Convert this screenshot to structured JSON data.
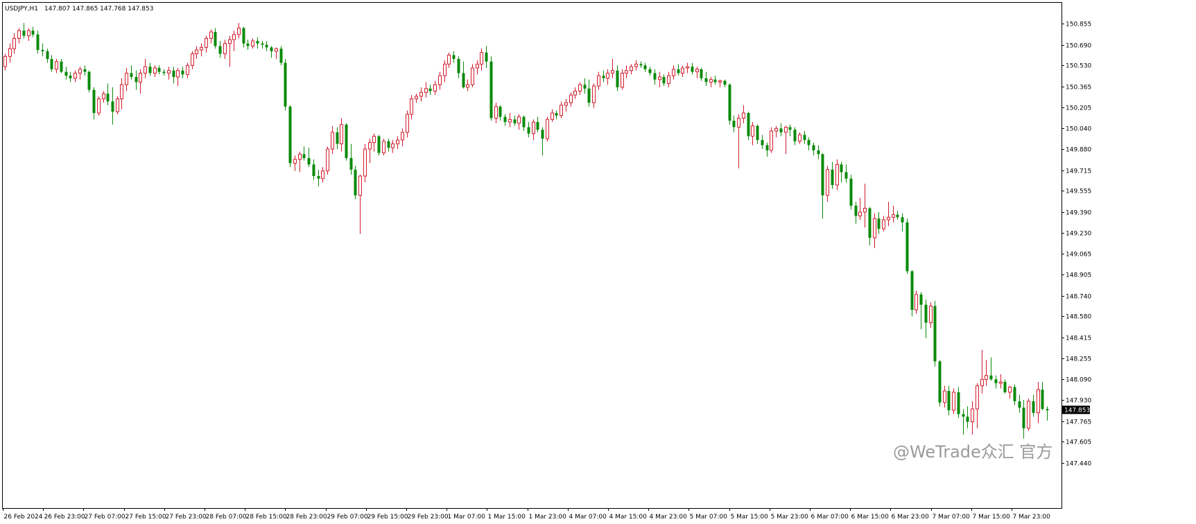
{
  "header": {
    "symbol": "USDJPY,H1",
    "ohlc_text": "147.807 147.865 147.768 147.853"
  },
  "current_price_label": "147.853",
  "watermark": "@WeTrade众汇 官方",
  "colors": {
    "bull": "#d11a2a",
    "bear": "#0a8a0a",
    "background": "#ffffff",
    "axis": "#000000"
  },
  "chart_data": {
    "type": "candlestick",
    "symbol": "USDJPY",
    "timeframe": "H1",
    "ylim": [
      147.44,
      150.92
    ],
    "y_ticks": [
      "150.855",
      "150.690",
      "150.530",
      "150.365",
      "150.205",
      "150.040",
      "149.880",
      "149.715",
      "149.555",
      "149.390",
      "149.230",
      "149.065",
      "148.905",
      "148.740",
      "148.580",
      "148.415",
      "148.255",
      "148.090",
      "147.930",
      "147.765",
      "147.605",
      "147.440"
    ],
    "x_ticks": [
      "26 Feb 2024",
      "26 Feb 23:00",
      "27 Feb 07:00",
      "27 Feb 15:00",
      "27 Feb 23:00",
      "28 Feb 07:00",
      "28 Feb 15:00",
      "28 Feb 23:00",
      "29 Feb 07:00",
      "29 Feb 15:00",
      "29 Feb 23:00",
      "1 Mar 07:00",
      "1 Mar 15:00",
      "1 Mar 23:00",
      "4 Mar 07:00",
      "4 Mar 15:00",
      "4 Mar 23:00",
      "5 Mar 07:00",
      "5 Mar 15:00",
      "5 Mar 23:00",
      "6 Mar 07:00",
      "6 Mar 15:00",
      "6 Mar 23:00",
      "7 Mar 07:00",
      "7 Mar 15:00",
      "7 Mar 23:00"
    ],
    "last_close": 147.853,
    "candles": [
      [
        150.52,
        150.62,
        150.49,
        150.6
      ],
      [
        150.6,
        150.7,
        150.55,
        150.66
      ],
      [
        150.66,
        150.78,
        150.62,
        150.74
      ],
      [
        150.74,
        150.82,
        150.7,
        150.8
      ],
      [
        150.8,
        150.86,
        150.74,
        150.76
      ],
      [
        150.76,
        150.82,
        150.72,
        150.8
      ],
      [
        150.8,
        150.83,
        150.75,
        150.77
      ],
      [
        150.77,
        150.8,
        150.62,
        150.65
      ],
      [
        150.65,
        150.7,
        150.6,
        150.64
      ],
      [
        150.64,
        150.66,
        150.55,
        150.58
      ],
      [
        150.58,
        150.61,
        150.48,
        150.5
      ],
      [
        150.5,
        150.58,
        150.47,
        150.56
      ],
      [
        150.56,
        150.58,
        150.47,
        150.48
      ],
      [
        150.48,
        150.52,
        150.42,
        150.45
      ],
      [
        150.45,
        150.48,
        150.4,
        150.43
      ],
      [
        150.43,
        150.49,
        150.4,
        150.47
      ],
      [
        150.47,
        150.52,
        150.42,
        150.5
      ],
      [
        150.5,
        150.53,
        150.45,
        150.48
      ],
      [
        150.48,
        150.49,
        150.32,
        150.34
      ],
      [
        150.34,
        150.36,
        150.11,
        150.16
      ],
      [
        150.16,
        150.29,
        150.14,
        150.27
      ],
      [
        150.27,
        150.33,
        150.24,
        150.31
      ],
      [
        150.31,
        150.39,
        150.22,
        150.25
      ],
      [
        150.25,
        150.36,
        150.07,
        150.17
      ],
      [
        150.17,
        150.29,
        150.15,
        150.27
      ],
      [
        150.27,
        150.43,
        150.19,
        150.38
      ],
      [
        150.38,
        150.51,
        150.33,
        150.47
      ],
      [
        150.47,
        150.53,
        150.42,
        150.44
      ],
      [
        150.44,
        150.49,
        150.34,
        150.4
      ],
      [
        150.4,
        150.5,
        150.31,
        150.47
      ],
      [
        150.47,
        150.58,
        150.43,
        150.52
      ],
      [
        150.52,
        150.55,
        150.45,
        150.47
      ],
      [
        150.47,
        150.53,
        150.44,
        150.51
      ],
      [
        150.51,
        150.53,
        150.46,
        150.48
      ],
      [
        150.48,
        150.5,
        150.45,
        150.47
      ],
      [
        150.47,
        150.52,
        150.42,
        150.49
      ],
      [
        150.49,
        150.52,
        150.39,
        150.44
      ],
      [
        150.44,
        150.51,
        150.37,
        150.49
      ],
      [
        150.49,
        150.52,
        150.43,
        150.46
      ],
      [
        150.46,
        150.55,
        150.43,
        150.53
      ],
      [
        150.53,
        150.64,
        150.5,
        150.62
      ],
      [
        150.62,
        150.68,
        150.58,
        150.65
      ],
      [
        150.65,
        150.7,
        150.6,
        150.67
      ],
      [
        150.67,
        150.76,
        150.63,
        150.74
      ],
      [
        150.74,
        150.81,
        150.7,
        150.79
      ],
      [
        150.79,
        150.82,
        150.66,
        150.68
      ],
      [
        150.68,
        150.72,
        150.59,
        150.62
      ],
      [
        150.62,
        150.73,
        150.58,
        150.7
      ],
      [
        150.7,
        150.76,
        150.52,
        150.73
      ],
      [
        150.73,
        150.8,
        150.64,
        150.77
      ],
      [
        150.77,
        150.86,
        150.74,
        150.82
      ],
      [
        150.82,
        150.83,
        150.67,
        150.7
      ],
      [
        150.7,
        150.73,
        150.65,
        150.68
      ],
      [
        150.68,
        150.74,
        150.66,
        150.72
      ],
      [
        150.72,
        150.75,
        150.66,
        150.7
      ],
      [
        150.7,
        150.72,
        150.66,
        150.69
      ],
      [
        150.69,
        150.72,
        150.64,
        150.67
      ],
      [
        150.67,
        150.68,
        150.59,
        150.64
      ],
      [
        150.64,
        150.67,
        150.58,
        150.66
      ],
      [
        150.66,
        150.68,
        150.53,
        150.55
      ],
      [
        150.55,
        150.58,
        150.18,
        150.21
      ],
      [
        150.21,
        150.22,
        149.74,
        149.77
      ],
      [
        149.77,
        149.83,
        149.71,
        149.8
      ],
      [
        149.8,
        149.86,
        149.7,
        149.84
      ],
      [
        149.84,
        149.9,
        149.79,
        149.81
      ],
      [
        149.81,
        149.89,
        149.74,
        149.76
      ],
      [
        149.76,
        149.8,
        149.64,
        149.67
      ],
      [
        149.67,
        149.72,
        149.59,
        149.65
      ],
      [
        149.65,
        149.74,
        149.62,
        149.71
      ],
      [
        149.71,
        149.9,
        149.68,
        149.88
      ],
      [
        149.88,
        150.06,
        149.84,
        150.01
      ],
      [
        150.01,
        150.05,
        149.88,
        149.92
      ],
      [
        149.92,
        150.12,
        149.86,
        150.07
      ],
      [
        150.07,
        150.08,
        149.79,
        149.81
      ],
      [
        149.81,
        149.92,
        149.68,
        149.72
      ],
      [
        149.72,
        149.75,
        149.49,
        149.52
      ],
      [
        149.52,
        149.68,
        149.22,
        149.67
      ],
      [
        149.67,
        149.92,
        149.62,
        149.88
      ],
      [
        149.88,
        149.96,
        149.77,
        149.93
      ],
      [
        149.93,
        150.0,
        149.86,
        149.98
      ],
      [
        149.98,
        149.99,
        149.83,
        149.85
      ],
      [
        149.85,
        149.96,
        149.83,
        149.94
      ],
      [
        149.94,
        149.96,
        149.86,
        149.89
      ],
      [
        149.89,
        149.95,
        149.85,
        149.92
      ],
      [
        149.92,
        149.98,
        149.88,
        149.95
      ],
      [
        149.95,
        150.04,
        149.9,
        150.01
      ],
      [
        150.01,
        150.18,
        149.97,
        150.15
      ],
      [
        150.15,
        150.3,
        150.11,
        150.27
      ],
      [
        150.27,
        150.31,
        150.24,
        150.29
      ],
      [
        150.29,
        150.36,
        150.25,
        150.32
      ],
      [
        150.32,
        150.4,
        150.28,
        150.35
      ],
      [
        150.35,
        150.38,
        150.3,
        150.33
      ],
      [
        150.33,
        150.41,
        150.3,
        150.38
      ],
      [
        150.38,
        150.48,
        150.34,
        150.45
      ],
      [
        150.45,
        150.57,
        150.4,
        150.54
      ],
      [
        150.54,
        150.63,
        150.51,
        150.61
      ],
      [
        150.61,
        150.64,
        150.55,
        150.58
      ],
      [
        150.58,
        150.6,
        150.43,
        150.47
      ],
      [
        150.47,
        150.56,
        150.35,
        150.36
      ],
      [
        150.36,
        150.42,
        150.33,
        150.38
      ],
      [
        150.38,
        150.54,
        150.36,
        150.51
      ],
      [
        150.51,
        150.57,
        150.46,
        150.54
      ],
      [
        150.54,
        150.66,
        150.49,
        150.63
      ],
      [
        150.63,
        150.68,
        150.51,
        150.56
      ],
      [
        150.56,
        150.6,
        150.1,
        150.12
      ],
      [
        150.12,
        150.24,
        150.08,
        150.21
      ],
      [
        150.21,
        150.22,
        150.1,
        150.13
      ],
      [
        150.13,
        150.15,
        150.06,
        150.09
      ],
      [
        150.09,
        150.16,
        150.05,
        150.11
      ],
      [
        150.11,
        150.14,
        150.06,
        150.08
      ],
      [
        150.08,
        150.15,
        150.03,
        150.13
      ],
      [
        150.13,
        150.14,
        150.02,
        150.05
      ],
      [
        150.05,
        150.09,
        149.97,
        150.0
      ],
      [
        150.0,
        150.11,
        149.95,
        150.09
      ],
      [
        150.09,
        150.13,
        150.01,
        150.03
      ],
      [
        150.03,
        150.05,
        149.83,
        149.96
      ],
      [
        149.96,
        150.13,
        149.94,
        150.11
      ],
      [
        150.11,
        150.19,
        150.09,
        150.16
      ],
      [
        150.16,
        150.18,
        150.11,
        150.14
      ],
      [
        150.14,
        150.25,
        150.12,
        150.22
      ],
      [
        150.22,
        150.27,
        150.17,
        150.24
      ],
      [
        150.24,
        150.32,
        150.21,
        150.3
      ],
      [
        150.3,
        150.36,
        150.27,
        150.33
      ],
      [
        150.33,
        150.4,
        150.3,
        150.38
      ],
      [
        150.38,
        150.43,
        150.31,
        150.35
      ],
      [
        150.35,
        150.42,
        150.21,
        150.24
      ],
      [
        150.24,
        150.39,
        150.2,
        150.37
      ],
      [
        150.37,
        150.48,
        150.34,
        150.45
      ],
      [
        150.45,
        150.49,
        150.4,
        150.43
      ],
      [
        150.43,
        150.5,
        150.38,
        150.47
      ],
      [
        150.47,
        150.58,
        150.43,
        150.49
      ],
      [
        150.49,
        150.53,
        150.33,
        150.36
      ],
      [
        150.36,
        150.5,
        150.34,
        150.47
      ],
      [
        150.47,
        150.53,
        150.43,
        150.49
      ],
      [
        150.49,
        150.54,
        150.46,
        150.52
      ],
      [
        150.52,
        150.57,
        150.49,
        150.54
      ],
      [
        150.54,
        150.56,
        150.51,
        150.53
      ],
      [
        150.53,
        150.55,
        150.48,
        150.5
      ],
      [
        150.5,
        150.52,
        150.45,
        150.47
      ],
      [
        150.47,
        150.5,
        150.38,
        150.42
      ],
      [
        150.42,
        150.48,
        150.36,
        150.44
      ],
      [
        150.44,
        150.46,
        150.37,
        150.39
      ],
      [
        150.39,
        150.48,
        150.36,
        150.45
      ],
      [
        150.45,
        150.53,
        150.42,
        150.5
      ],
      [
        150.5,
        150.54,
        150.45,
        150.47
      ],
      [
        150.47,
        150.53,
        150.44,
        150.51
      ],
      [
        150.51,
        150.55,
        150.47,
        150.52
      ],
      [
        150.52,
        150.55,
        150.46,
        150.48
      ],
      [
        150.48,
        150.52,
        150.43,
        150.5
      ],
      [
        150.5,
        150.51,
        150.41,
        150.43
      ],
      [
        150.43,
        150.48,
        150.37,
        150.4
      ],
      [
        150.4,
        150.44,
        150.36,
        150.42
      ],
      [
        150.42,
        150.45,
        150.38,
        150.4
      ],
      [
        150.4,
        150.42,
        150.36,
        150.41
      ],
      [
        150.41,
        150.42,
        150.36,
        150.38
      ],
      [
        150.38,
        150.39,
        150.07,
        150.1
      ],
      [
        150.1,
        150.14,
        150.01,
        150.05
      ],
      [
        150.05,
        150.15,
        149.73,
        150.12
      ],
      [
        150.12,
        150.22,
        150.08,
        150.16
      ],
      [
        150.16,
        150.17,
        149.95,
        149.98
      ],
      [
        149.98,
        150.09,
        149.91,
        150.06
      ],
      [
        150.06,
        150.07,
        149.92,
        149.95
      ],
      [
        149.95,
        149.99,
        149.88,
        149.91
      ],
      [
        149.91,
        149.93,
        149.82,
        149.87
      ],
      [
        149.87,
        150.05,
        149.85,
        150.02
      ],
      [
        150.02,
        150.06,
        149.97,
        150.04
      ],
      [
        150.04,
        150.08,
        149.98,
        150.01
      ],
      [
        150.01,
        150.06,
        149.84,
        150.05
      ],
      [
        150.05,
        150.07,
        149.98,
        150.03
      ],
      [
        150.03,
        150.05,
        149.91,
        149.94
      ],
      [
        149.94,
        150.01,
        149.92,
        149.99
      ],
      [
        149.99,
        150.02,
        149.92,
        149.95
      ],
      [
        149.95,
        149.97,
        149.87,
        149.91
      ],
      [
        149.91,
        149.93,
        149.83,
        149.87
      ],
      [
        149.87,
        149.91,
        149.8,
        149.84
      ],
      [
        149.84,
        149.85,
        149.34,
        149.52
      ],
      [
        149.52,
        149.75,
        149.47,
        149.72
      ],
      [
        149.72,
        149.78,
        149.57,
        149.6
      ],
      [
        149.6,
        149.8,
        149.56,
        149.76
      ],
      [
        149.76,
        149.78,
        149.62,
        149.7
      ],
      [
        149.7,
        149.76,
        149.62,
        149.65
      ],
      [
        149.65,
        149.68,
        149.41,
        149.44
      ],
      [
        149.44,
        149.47,
        149.3,
        149.36
      ],
      [
        149.36,
        149.5,
        149.33,
        149.39
      ],
      [
        149.39,
        149.61,
        149.27,
        149.42
      ],
      [
        149.42,
        149.43,
        149.13,
        149.19
      ],
      [
        149.19,
        149.38,
        149.11,
        149.34
      ],
      [
        149.34,
        149.39,
        149.22,
        149.26
      ],
      [
        149.26,
        149.36,
        149.24,
        149.33
      ],
      [
        149.33,
        149.47,
        149.28,
        149.35
      ],
      [
        149.35,
        149.44,
        149.31,
        149.37
      ],
      [
        149.37,
        149.4,
        149.33,
        149.35
      ],
      [
        149.35,
        149.38,
        149.24,
        149.31
      ],
      [
        149.31,
        149.34,
        148.91,
        148.93
      ],
      [
        148.93,
        148.94,
        148.58,
        148.63
      ],
      [
        148.63,
        148.78,
        148.6,
        148.75
      ],
      [
        148.75,
        148.77,
        148.48,
        148.67
      ],
      [
        148.67,
        148.71,
        148.41,
        148.53
      ],
      [
        148.53,
        148.69,
        148.49,
        148.66
      ],
      [
        148.66,
        148.7,
        148.19,
        148.23
      ],
      [
        148.23,
        148.24,
        147.88,
        147.91
      ],
      [
        147.91,
        148.04,
        147.87,
        148.0
      ],
      [
        148.0,
        148.04,
        147.81,
        147.85
      ],
      [
        147.85,
        148.02,
        147.82,
        147.99
      ],
      [
        147.99,
        148.03,
        147.79,
        147.82
      ],
      [
        147.82,
        147.86,
        147.66,
        147.8
      ],
      [
        147.8,
        147.88,
        147.71,
        147.76
      ],
      [
        147.76,
        147.92,
        147.66,
        147.86
      ],
      [
        147.86,
        148.06,
        147.71,
        148.04
      ],
      [
        148.04,
        148.32,
        147.98,
        148.09
      ],
      [
        148.09,
        148.24,
        148.04,
        148.12
      ],
      [
        148.12,
        148.26,
        148.08,
        148.09
      ],
      [
        148.09,
        148.12,
        148.02,
        148.06
      ],
      [
        148.06,
        148.13,
        148.02,
        148.07
      ],
      [
        148.07,
        148.09,
        147.98,
        147.99
      ],
      [
        147.99,
        148.04,
        147.94,
        148.03
      ],
      [
        148.03,
        148.05,
        147.89,
        147.92
      ],
      [
        147.92,
        147.97,
        147.83,
        147.87
      ],
      [
        147.87,
        147.93,
        147.63,
        147.71
      ],
      [
        147.71,
        147.94,
        147.69,
        147.92
      ],
      [
        147.92,
        147.97,
        147.8,
        147.83
      ],
      [
        147.83,
        148.07,
        147.75,
        148.01
      ],
      [
        148.01,
        148.07,
        147.85,
        147.86
      ],
      [
        147.86,
        147.88,
        147.77,
        147.85
      ]
    ]
  }
}
